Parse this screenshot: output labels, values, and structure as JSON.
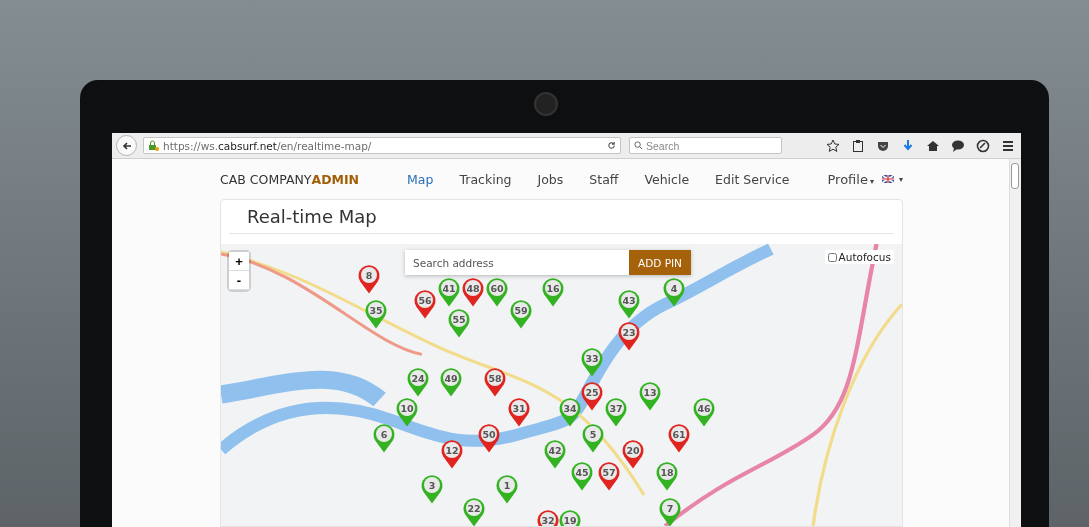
{
  "browser": {
    "url": "https://ws.**cabsurf.net**/en/realtime-map/",
    "search": {
      "placeholder": "Search"
    }
  },
  "brand": {
    "name": "CAB COMPANY",
    "suffix": "ADMIN"
  },
  "nav": [
    {
      "label": "Map",
      "selected": true
    },
    {
      "label": "Tracking",
      "selected": false
    },
    {
      "label": "Jobs",
      "selected": false
    },
    {
      "label": "Staff",
      "selected": false
    },
    {
      "label": "Vehicle",
      "selected": false
    },
    {
      "label": "Edit Service",
      "selected": false
    }
  ],
  "profile": {
    "label": "Profile",
    "caret": "▾",
    "language_caret": "▾"
  },
  "page_title": "Real-time Map",
  "map": {
    "zoom_in": "+",
    "zoom_out": "-",
    "search": {
      "placeholder": "Search address"
    },
    "add_button": "ADD PIN",
    "autofocus": {
      "label": "Autofocus",
      "checked": false
    },
    "pins": [
      {
        "label": "8",
        "color": "#e0241f"
      },
      {
        "label": "41",
        "color": "#33b322"
      },
      {
        "label": "48",
        "color": "#e0241f"
      },
      {
        "label": "60",
        "color": "#33b322"
      },
      {
        "label": "16",
        "color": "#33b322"
      },
      {
        "label": "4",
        "color": "#33b322"
      },
      {
        "label": "56",
        "color": "#e0241f"
      },
      {
        "label": "43",
        "color": "#33b322"
      },
      {
        "label": "35",
        "color": "#33b322"
      },
      {
        "label": "59",
        "color": "#33b322"
      },
      {
        "label": "55",
        "color": "#33b322"
      },
      {
        "label": "23",
        "color": "#e0241f"
      },
      {
        "label": "33",
        "color": "#33b322"
      },
      {
        "label": "24",
        "color": "#33b322"
      },
      {
        "label": "49",
        "color": "#33b322"
      },
      {
        "label": "58",
        "color": "#e0241f"
      },
      {
        "label": "25",
        "color": "#e0241f"
      },
      {
        "label": "13",
        "color": "#33b322"
      },
      {
        "label": "10",
        "color": "#33b322"
      },
      {
        "label": "31",
        "color": "#e0241f"
      },
      {
        "label": "34",
        "color": "#33b322"
      },
      {
        "label": "37",
        "color": "#33b322"
      },
      {
        "label": "46",
        "color": "#33b322"
      },
      {
        "label": "6",
        "color": "#33b322"
      },
      {
        "label": "50",
        "color": "#e0241f"
      },
      {
        "label": "5",
        "color": "#33b322"
      },
      {
        "label": "61",
        "color": "#e0241f"
      },
      {
        "label": "12",
        "color": "#e0241f"
      },
      {
        "label": "42",
        "color": "#33b322"
      },
      {
        "label": "20",
        "color": "#e0241f"
      },
      {
        "label": "45",
        "color": "#33b322"
      },
      {
        "label": "57",
        "color": "#e0241f"
      },
      {
        "label": "18",
        "color": "#33b322"
      },
      {
        "label": "3",
        "color": "#33b322"
      },
      {
        "label": "1",
        "color": "#33b322"
      },
      {
        "label": "22",
        "color": "#33b322"
      },
      {
        "label": "7",
        "color": "#33b322"
      },
      {
        "label": "32",
        "color": "#e0241f"
      },
      {
        "label": "19",
        "color": "#33b322"
      }
    ]
  }
}
